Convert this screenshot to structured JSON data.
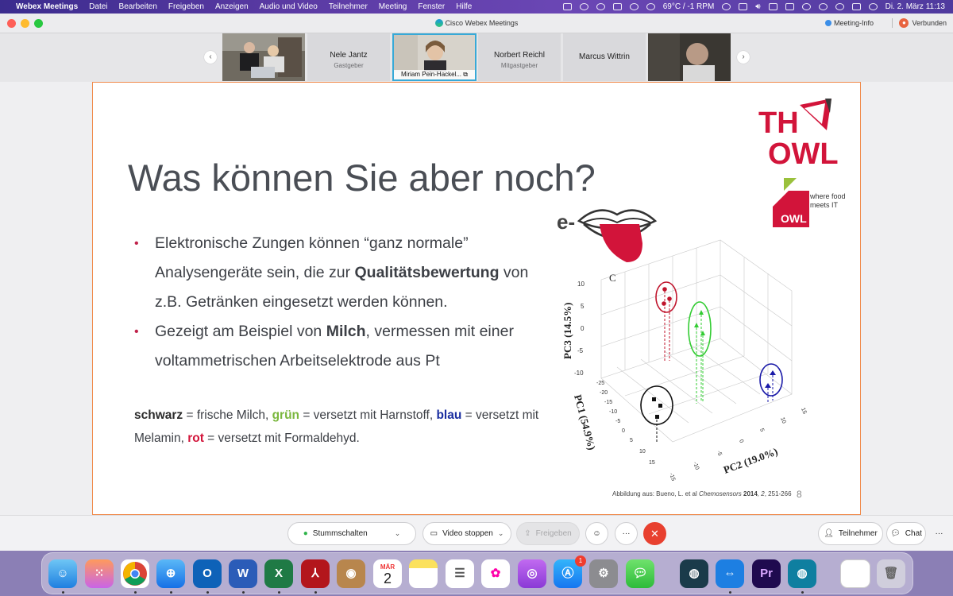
{
  "menubar": {
    "app_name": "Webex Meetings",
    "items": [
      "Datei",
      "Bearbeiten",
      "Freigeben",
      "Anzeigen",
      "Audio und Video",
      "Teilnehmer",
      "Meeting",
      "Fenster",
      "Hilfe"
    ],
    "weather": "69°C / -1 RPM",
    "datetime": "Di. 2. März  11:13"
  },
  "window": {
    "title": "Cisco Webex Meetings",
    "meeting_info": "Meeting-Info",
    "connection": "Verbunden"
  },
  "participants": [
    {
      "kind": "video"
    },
    {
      "name": "Nele Jantz",
      "role": "Gastgeber"
    },
    {
      "caption": "Miriam Pein-Hackel...",
      "kind": "video-active"
    },
    {
      "name": "Norbert Reichl",
      "role": "Mitgastgeber"
    },
    {
      "name": "Marcus Wittrin",
      "role": ""
    },
    {
      "kind": "video"
    }
  ],
  "slide": {
    "title": "Was können Sie aber noch?",
    "bullet1": {
      "pre": "Elektronische Zungen können “ganz normale” Analysengeräte sein, die zur ",
      "bold": "Qualitätsbewertung",
      "post": " von z.B. Getränken eingesetzt werden können."
    },
    "bullet2": {
      "pre": "Gezeigt am Beispiel von ",
      "bold": "Milch",
      "post": ", vermessen mit einer voltammetrischen Arbeitselektrode aus Pt"
    },
    "legend": {
      "black_label": "schwarz",
      "black_text": " = frische Milch, ",
      "green_label": "grün",
      "green_text": " = versetzt mit Harnstoff, ",
      "blue_label": "blau",
      "blue_text": " = versetzt mit Melamin, ",
      "red_label": "rot",
      "red_text": " = versetzt mit Formaldehyd."
    },
    "citation_pre": "Abbildung aus: Bueno, L. et al ",
    "citation_journal": "Chemosensors",
    "citation_year": "2014",
    "citation_vol": ", 2",
    "citation_pages": ", 251-266",
    "page_number": "8",
    "logo_th": "TH",
    "logo_owl": "OWL",
    "owl2_text": "OWL",
    "owl2_tagline_1": "where food",
    "owl2_tagline_2": "meets IT",
    "e_prefix": "e-",
    "plot": {
      "panel_label": "C",
      "z_axis": "PC3 (14.5%)",
      "y_axis": "PC1 (54.9%)",
      "x_axis": "PC2 (19.0%)",
      "z_ticks": [
        "10",
        "5",
        "0",
        "-5",
        "-10"
      ],
      "pc1_ticks": [
        "-25",
        "-20",
        "-15",
        "-10",
        "-5",
        "0",
        "5",
        "10",
        "15"
      ],
      "pc2_ticks": [
        "-15",
        "-10",
        "-5",
        "0",
        "5",
        "10",
        "15"
      ],
      "colors": {
        "black": "#111111",
        "green": "#33cc33",
        "blue": "#1a1aa8",
        "red": "#c0142c"
      }
    }
  },
  "toolbar": {
    "mute": "Stummschalten",
    "video": "Video stoppen",
    "share": "Freigeben",
    "participants": "Teilnehmer",
    "chat": "Chat"
  },
  "dock": {
    "calendar_month": "MÄR",
    "calendar_day": "2",
    "appstore_badge": "1",
    "word": "W",
    "excel": "X",
    "outlook": "O",
    "premiere": "Pr"
  }
}
